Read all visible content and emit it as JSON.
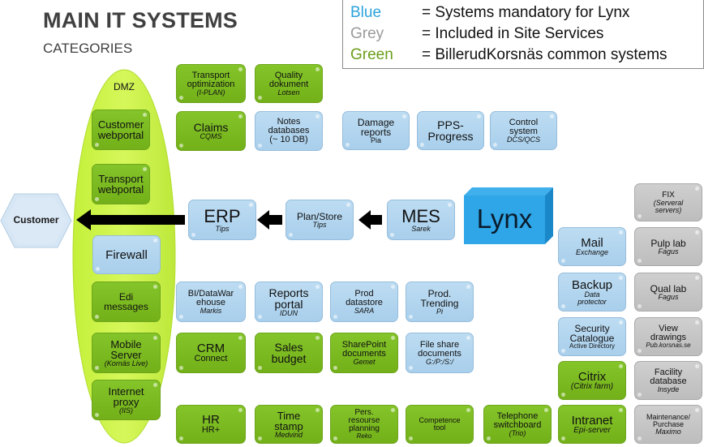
{
  "header": {
    "title": "MAIN IT SYSTEMS",
    "subtitle": "CATEGORIES"
  },
  "legend": [
    {
      "key": "Blue",
      "desc": "= Systems mandatory for Lynx",
      "color": "#2ba3dc"
    },
    {
      "key": "Grey",
      "desc": "= Included in Site Services",
      "color": "#9a9a9a"
    },
    {
      "key": "Green",
      "desc": "= BillerudKorsnäs common systems",
      "color": "#6a9e1a"
    }
  ],
  "dmz": {
    "label": "DMZ"
  },
  "customer": {
    "label": "Customer"
  },
  "lynx": {
    "label": "Lynx"
  },
  "systems": {
    "customer_webportal": {
      "l1": "Customer",
      "l2": "webportal"
    },
    "transport_webportal": {
      "l1": "Transport",
      "l2": "webportal"
    },
    "firewall": {
      "l1": "Firewall"
    },
    "edi": {
      "l1": "Edi",
      "l2": "messages"
    },
    "mobile": {
      "l1": "Mobile",
      "l2": "Server",
      "sub": "(Kornäs Live)"
    },
    "proxy": {
      "l1": "Internet",
      "l2": "proxy",
      "sub": "(IIS)"
    },
    "transport_opt": {
      "l1": "Transport",
      "l2": "optimization",
      "sub": "(I-PLAN)"
    },
    "quality": {
      "l1": "Quality",
      "l2": "dokument",
      "sub": "Lotsen"
    },
    "claims": {
      "l1": "Claims",
      "sub": "CQMS"
    },
    "notes": {
      "l1": "Notes",
      "l2": "databases",
      "l3": "(~ 10 DB)"
    },
    "damage": {
      "l1": "Damage",
      "l2": "reports",
      "sub": "Pia"
    },
    "pps": {
      "l1": "PPS-",
      "l2": "Progress"
    },
    "control": {
      "l1": "Control",
      "l2": "system",
      "sub": "DCS/QCS"
    },
    "erp": {
      "l1": "ERP",
      "sub": "Tips"
    },
    "planstore": {
      "l1": "Plan/Store",
      "sub": "Tips"
    },
    "mes": {
      "l1": "MES",
      "sub": "Sarek"
    },
    "bi": {
      "l1": "BI/DataWar",
      "l2": "ehouse",
      "sub": "Markis"
    },
    "reports": {
      "l1": "Reports",
      "l2": "portal",
      "sub": "IDUN"
    },
    "prod_datastore": {
      "l1": "Prod",
      "l2": "datastore",
      "sub": "SARA"
    },
    "prod_trending": {
      "l1": "Prod.",
      "l2": "Trending",
      "sub": "Pi"
    },
    "crm": {
      "l1": "CRM",
      "l2": "Connect"
    },
    "sales": {
      "l1": "Sales",
      "l2": "budget"
    },
    "sharepoint": {
      "l1": "SharePoint",
      "l2": "documents",
      "sub": "Gemet"
    },
    "fileshare": {
      "l1": "File share",
      "l2": "documents",
      "sub": "G:/P:/S:/"
    },
    "hr": {
      "l1": "HR",
      "l2": "HR+"
    },
    "timestamp": {
      "l1": "Time",
      "l2": "stamp",
      "sub": "Medvind"
    },
    "pers": {
      "l1": "Pers.",
      "l2": "resourse",
      "l3": "planning",
      "sub": "Reko"
    },
    "competence": {
      "l1": "Competence",
      "l2": "tool"
    },
    "telephone": {
      "l1": "Telephone",
      "l2": "switchboard",
      "sub": "(Trio)"
    },
    "mail": {
      "l1": "Mail",
      "sub": "Exchange"
    },
    "backup": {
      "l1": "Backup",
      "sub1": "Data",
      "sub2": "protector"
    },
    "security": {
      "l1": "Security",
      "l2": "Catalogue",
      "l3": "Active Directory"
    },
    "citrix": {
      "l1": "Citrix",
      "sub": "(Citrix farm)"
    },
    "intranet": {
      "l1": "Intranet",
      "sub": "Epi-server"
    },
    "fix": {
      "l1": "FIX",
      "sub1": "(Serveral",
      "sub2": "servers)"
    },
    "pulplab": {
      "l1": "Pulp lab",
      "sub": "Fagus"
    },
    "quallab": {
      "l1": "Qual lab",
      "sub": "Fagus"
    },
    "view": {
      "l1": "View",
      "l2": "drawings",
      "sub": "Pub.korsnas.se"
    },
    "facility": {
      "l1": "Facility",
      "l2": "database",
      "sub": "Insyde"
    },
    "maintenance": {
      "l1": "Maintenance/",
      "l2": "Purchase",
      "sub": "Maximo"
    }
  }
}
